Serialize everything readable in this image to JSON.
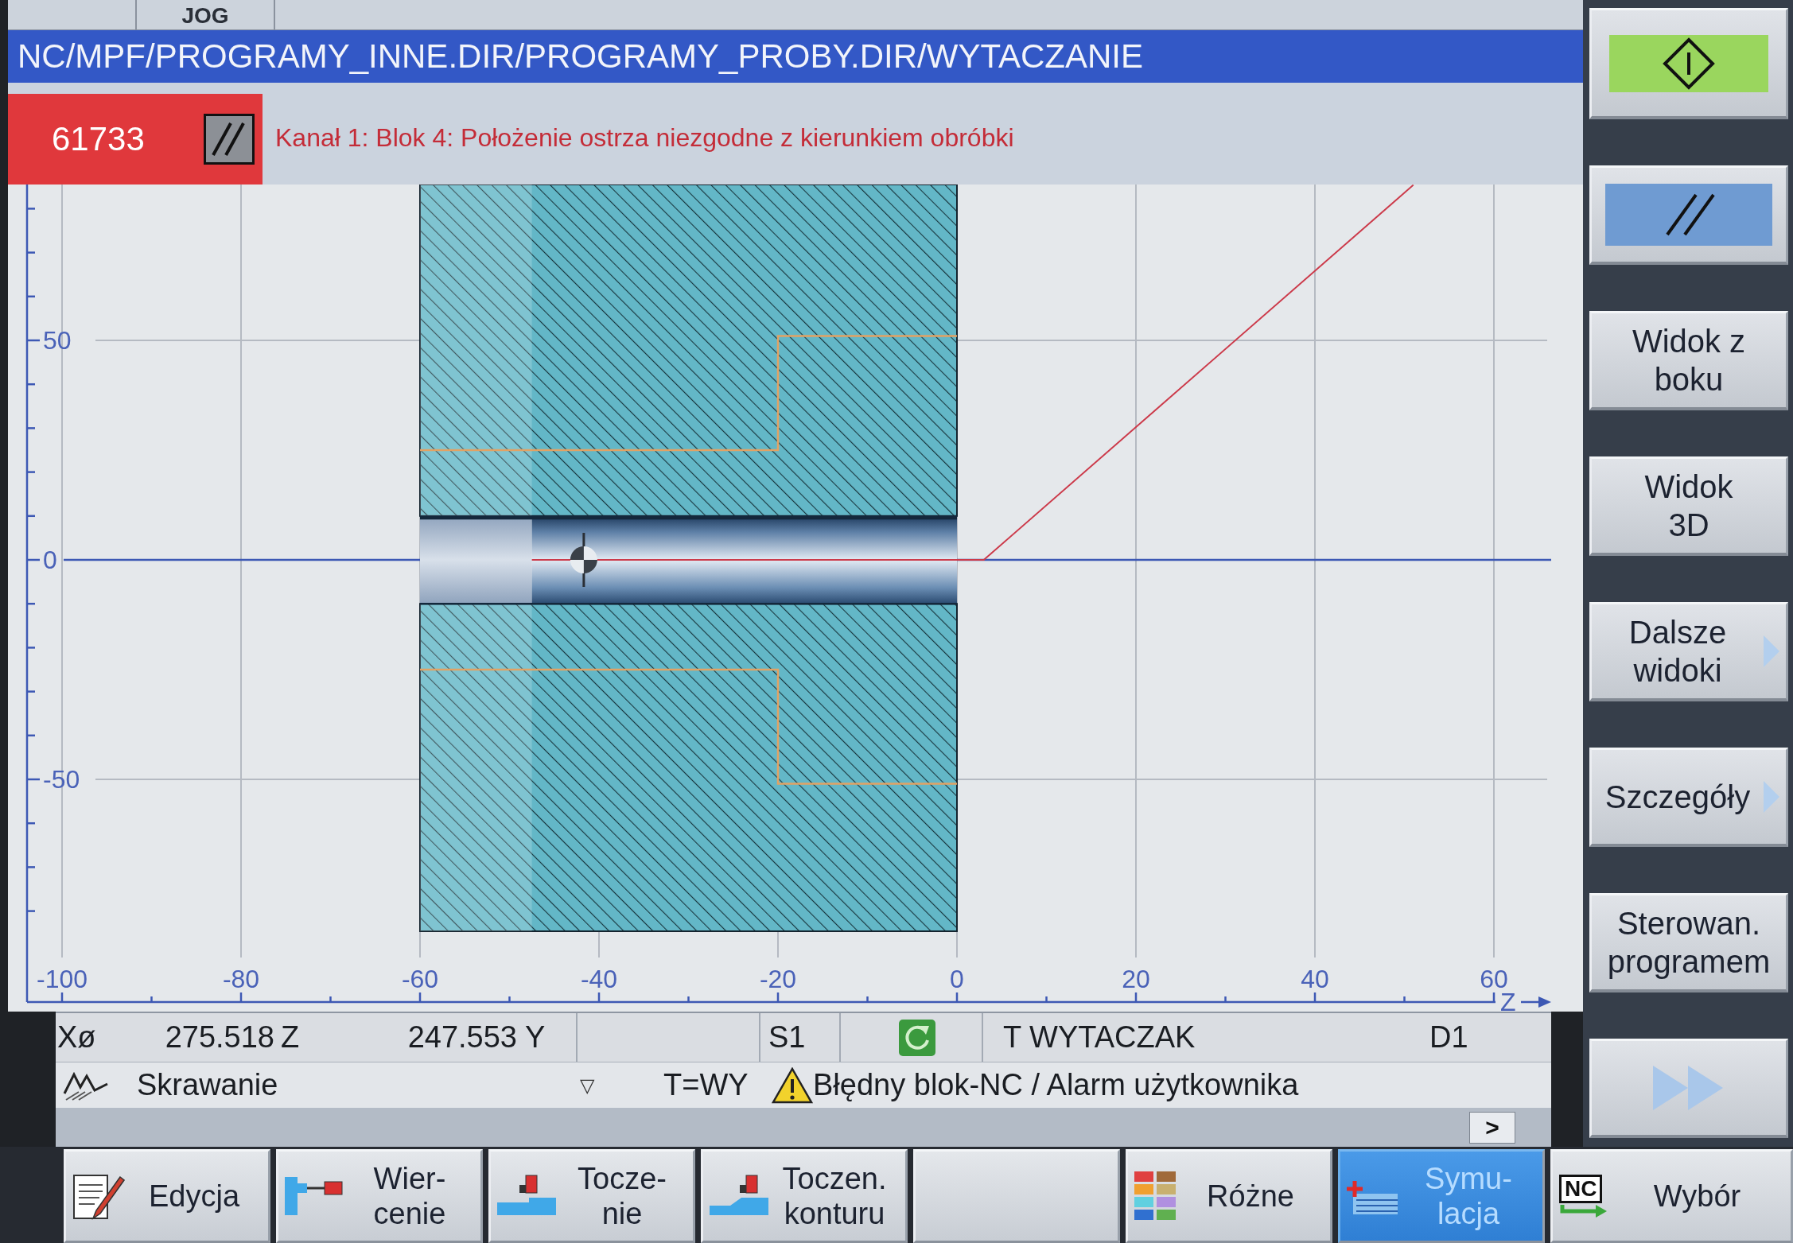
{
  "mode_tab": {
    "label": "JOG"
  },
  "path_bar": {
    "path": "NC/MPF/PROGRAMY_INNE.DIR/PROGRAMY_PROBY.DIR/WYTACZANIE"
  },
  "alarm": {
    "number": "61733",
    "message": "Kanał 1: Blok 4: Położenie ostrza niezgodne z kierunkiem obróbki"
  },
  "simulation": {
    "z_ticks": [
      "-100",
      "-80",
      "-60",
      "-40",
      "-20",
      "0",
      "20",
      "40",
      "60"
    ],
    "x_ticks": [
      "50",
      "0",
      "-50"
    ],
    "axis_label": "Z"
  },
  "position_bar": {
    "x_label": "Xø",
    "x_value": "275.518",
    "z_label": "Z",
    "z_value": "247.553",
    "y_label": "Y",
    "spindle": "S1",
    "tool": "T WYTACZAK",
    "cutting_edge": "D1"
  },
  "status_bar": {
    "mode": "Skrawanie",
    "dropdown_glyph": "▽",
    "tool_short": "T=WY",
    "message": "Błędny blok-NC / Alarm użytkownika",
    "more_glyph": ">"
  },
  "vertical_softkeys": [
    {
      "kind": "start"
    },
    {
      "kind": "reset"
    },
    {
      "kind": "text",
      "lines": [
        "Widok z",
        "boku"
      ]
    },
    {
      "kind": "text",
      "lines": [
        "Widok",
        "3D"
      ]
    },
    {
      "kind": "menu",
      "lines": [
        "Dalsze",
        "widoki"
      ]
    },
    {
      "kind": "menu",
      "lines": [
        "Szczegóły"
      ]
    },
    {
      "kind": "text",
      "lines": [
        "Sterowan.",
        "programem"
      ]
    },
    {
      "kind": "next"
    }
  ],
  "horizontal_softkeys": [
    {
      "kind": "edit",
      "lines": [
        "Edycja"
      ],
      "selected": false
    },
    {
      "kind": "drill",
      "lines": [
        "Wier-",
        "cenie"
      ],
      "selected": false
    },
    {
      "kind": "turning",
      "lines": [
        "Tocze-",
        "nie"
      ],
      "selected": false
    },
    {
      "kind": "contour",
      "lines": [
        "Toczen.",
        "konturu"
      ],
      "selected": false
    },
    {
      "kind": "blank",
      "selected": false
    },
    {
      "kind": "misc",
      "lines": [
        "Różne"
      ],
      "selected": false
    },
    {
      "kind": "simulation",
      "lines": [
        "Symu-",
        "lacja"
      ],
      "selected": true
    },
    {
      "kind": "select",
      "icon_text": "NC",
      "lines": [
        "Wybór"
      ],
      "selected": false
    }
  ]
}
